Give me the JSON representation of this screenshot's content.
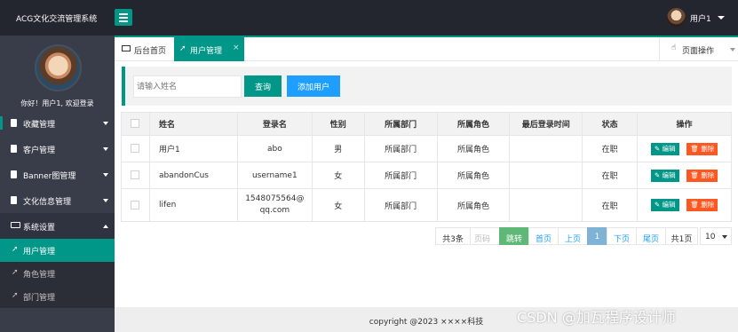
{
  "app": {
    "title": "ACG文化交流管理系统",
    "user": "用户1"
  },
  "sidebar": {
    "greeting": "你好！用户1, 欢迎登录",
    "groups": [
      {
        "label": "收藏管理"
      },
      {
        "label": "客户管理"
      },
      {
        "label": "Banner图管理"
      },
      {
        "label": "文化信息管理"
      },
      {
        "label": "系统设置"
      }
    ],
    "sub_items": [
      {
        "label": "用户管理"
      },
      {
        "label": "角色管理"
      },
      {
        "label": "部门管理"
      }
    ]
  },
  "tabs": {
    "home": "后台首页",
    "current": "用户管理",
    "close": "×",
    "page_ops": "页面操作"
  },
  "search": {
    "placeholder": "请输入姓名",
    "query": "查询",
    "add": "添加用户"
  },
  "table": {
    "headers": [
      "姓名",
      "登录名",
      "性别",
      "所属部门",
      "所属角色",
      "最后登录时间",
      "状态",
      "操作"
    ],
    "rows": [
      {
        "name": "用户1",
        "login": "abo",
        "gender": "男",
        "dept": "所属部门",
        "role": "所属角色",
        "last": "",
        "status": "在职"
      },
      {
        "name": "abandonCus",
        "login": "username1",
        "gender": "女",
        "dept": "所属部门",
        "role": "所属角色",
        "last": "",
        "status": "在职"
      },
      {
        "name": "lifen",
        "login": "1548075564@qq.com",
        "gender": "女",
        "dept": "所属部门",
        "role": "所属角色",
        "last": "",
        "status": "在职"
      }
    ],
    "edit": "编辑",
    "delete": "删除"
  },
  "pager": {
    "total": "共3条",
    "page_input": "页码",
    "jump": "跳转",
    "first": "首页",
    "prev": "上页",
    "current": "1",
    "next": "下页",
    "last": "尾页",
    "pages": "共1页",
    "size": "10"
  },
  "footer": {
    "copyright": "copyright @2023 ××××科技"
  },
  "watermark": "CSDN @加瓦程序设计师"
}
